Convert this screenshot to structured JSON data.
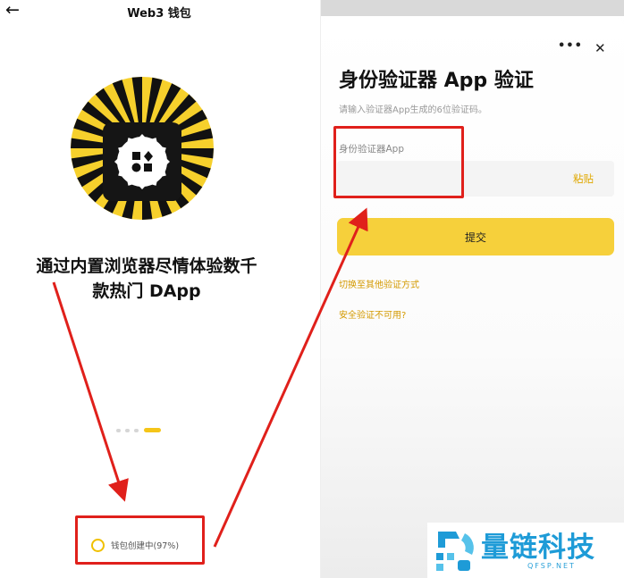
{
  "left_screen": {
    "title": "Web3 钱包",
    "back_icon": "arrow-left-icon",
    "headline_line1": "通过内置浏览器尽情体验数千",
    "headline_line2": "款热门 DApp",
    "carousel": {
      "total": 4,
      "active": 4
    },
    "status": {
      "text": "钱包创建中(97%)",
      "progress_percent": 97
    }
  },
  "right_screen": {
    "more_label": "•••",
    "close_label": "✕",
    "title": "身份验证器 App 验证",
    "subtitle": "请输入验证器App生成的6位验证码。",
    "field_label": "身份验证器App",
    "field_value": "",
    "paste_label": "粘贴",
    "submit_label": "提交",
    "switch_link": "切换至其他验证方式",
    "unavailable_link": "安全验证不可用?"
  },
  "watermark": {
    "brand": "量链科技",
    "url": "QFSP.NET"
  },
  "colors": {
    "accent_yellow": "#f6d03b",
    "link_gold": "#d49a00",
    "annotation_red": "#e0201b",
    "watermark_blue": "#1e9bd7"
  }
}
